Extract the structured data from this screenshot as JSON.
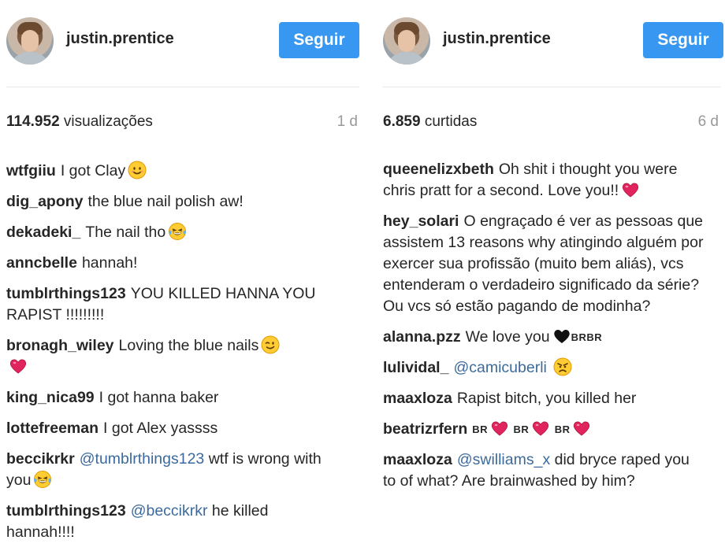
{
  "left": {
    "username": "justin.prentice",
    "follow_label": "Seguir",
    "stats_count": "114.952",
    "stats_label": "visualizações",
    "age": "1 d",
    "comments": [
      {
        "user": "wtfgiiu",
        "text": "I got Clay",
        "emoji": "smiling-face-icon"
      },
      {
        "user": "dig_apony",
        "text": "the blue nail polish aw!"
      },
      {
        "user": "dekadeki_",
        "text": "The nail tho",
        "emoji": "tears-of-joy-icon"
      },
      {
        "user": "anncbelle",
        "text": "hannah!"
      },
      {
        "user": "tumblrthings123",
        "text": "YOU KILLED HANNA YOU RAPIST !!!!!!!!!"
      },
      {
        "user": "bronagh_wiley",
        "text": "Loving the blue nails",
        "emoji": "winking-face-icon",
        "emoji2": "red-heart-icon"
      },
      {
        "user": "king_nica99",
        "text": "I got hanna baker"
      },
      {
        "user": "lottefreeman",
        "text": "I got Alex yassss"
      },
      {
        "user": "beccikrkr",
        "mention": "@tumblrthings123",
        "text": "wtf is wrong with you",
        "emoji": "tears-of-joy-icon"
      },
      {
        "user": "tumblrthings123",
        "mention": "@beccikrkr",
        "text": "he killed hannah!!!!"
      }
    ]
  },
  "right": {
    "username": "justin.prentice",
    "follow_label": "Seguir",
    "stats_count": "6.859",
    "stats_label": "curtidas",
    "age": "6 d",
    "comments": [
      {
        "user": "queenelizxbeth",
        "text": "Oh shit i thought you were chris pratt for a second. Love you!!",
        "emoji": "red-heart-icon"
      },
      {
        "user": "hey_solari",
        "text": "O engraçado é ver as pessoas que assistem 13 reasons why atingindo alguém por exercer sua profissão (muito bem aliás), vcs entenderam o verdadeiro significado da série? Ou vcs só estão pagando de modinha?"
      },
      {
        "user": "alanna.pzz",
        "text": "We love you",
        "emoji": "black-heart-icon",
        "suffix": "BRBR"
      },
      {
        "user": "lulividal_",
        "mention": "@camicuberli",
        "text": "",
        "emoji": "angry-face-icon"
      },
      {
        "user": "maaxloza",
        "text": "Rapist bitch, you killed her"
      },
      {
        "user": "beatrizrfern",
        "text": "",
        "br_hearts": [
          "BR",
          "BR",
          "BR"
        ]
      },
      {
        "user": "maaxloza",
        "mention": "@swilliams_x",
        "text": "did bryce raped you to of what? Are brainwashed by him?"
      }
    ]
  },
  "colors": {
    "follow_button": "#3897f0",
    "mention": "#3c6a9c",
    "heart": "#e0245e",
    "muted": "#999999"
  }
}
